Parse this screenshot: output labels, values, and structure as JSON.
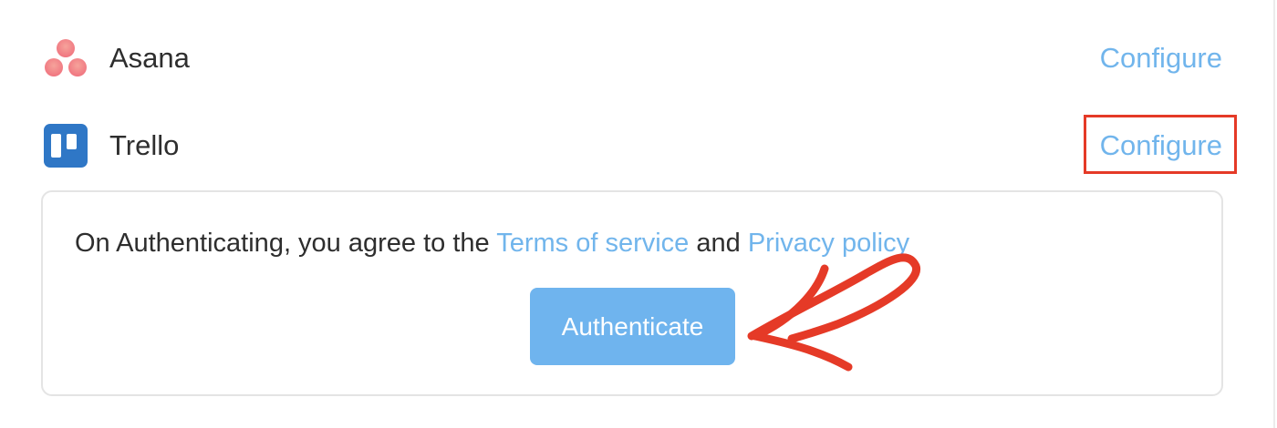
{
  "integrations": [
    {
      "name": "Asana",
      "icon": "asana-logo-icon",
      "action_label": "Configure"
    },
    {
      "name": "Trello",
      "icon": "trello-logo-icon",
      "action_label": "Configure"
    }
  ],
  "auth_panel": {
    "agreement_prefix": "On Authenticating, you agree to the",
    "terms_link": "Terms of service",
    "conjunction": "and",
    "privacy_link": "Privacy policy",
    "button_label": "Authenticate"
  },
  "annotations": {
    "highlight": "configure-trello",
    "arrow_target": "authenticate-button"
  },
  "colors": {
    "link": "#71b5ec",
    "button": "#6fb4ee",
    "annotation": "#e53a27",
    "asana": "#f07a7a",
    "trello": "#2f77c6"
  }
}
